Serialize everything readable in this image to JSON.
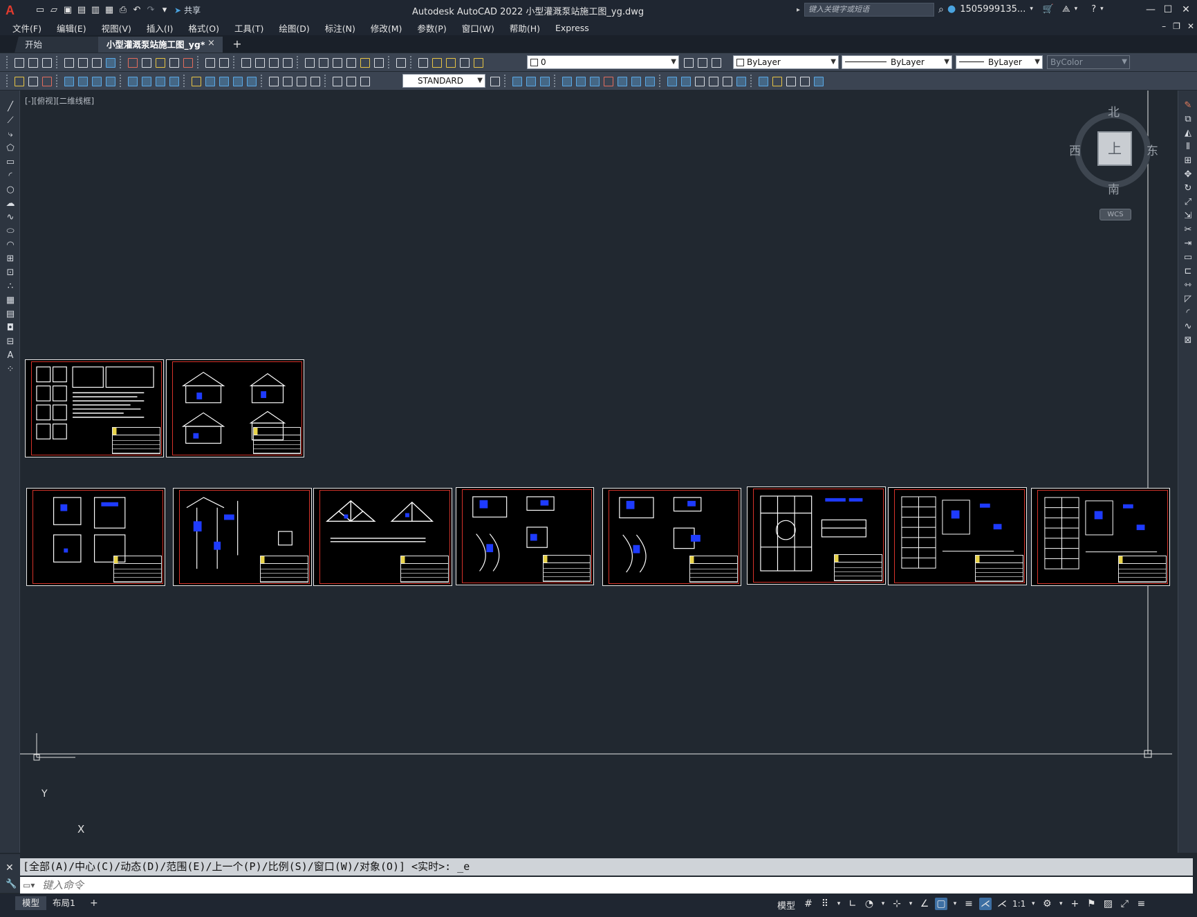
{
  "titlebar": {
    "app_logo": "A",
    "share_label": "共享",
    "title": "Autodesk AutoCAD 2022    小型灌溉泵站施工图_yg.dwg",
    "search_placeholder": "键入关键字或短语",
    "user": "1505999135...",
    "icons": [
      "new-icon",
      "open-icon",
      "save-icon",
      "saveas-icon",
      "print-icon",
      "undo-icon",
      "redo-icon",
      "share-icon",
      "search-icon",
      "user-icon",
      "cart-icon",
      "help-icon",
      "minimize-icon",
      "maximize-icon",
      "close-icon"
    ]
  },
  "menu": {
    "items": [
      "文件(F)",
      "编辑(E)",
      "视图(V)",
      "插入(I)",
      "格式(O)",
      "工具(T)",
      "绘图(D)",
      "标注(N)",
      "修改(M)",
      "参数(P)",
      "窗口(W)",
      "帮助(H)",
      "Express"
    ]
  },
  "tabs": {
    "start": "开始",
    "document": "小型灌溉泵站施工图_yg*",
    "close_glyph": "×",
    "add_glyph": "+"
  },
  "toolbar": {
    "layer": "0",
    "color": "ByLayer",
    "linetype": "ByLayer",
    "lineweight": "ByLayer",
    "plotstyle": "ByColor",
    "textstyle": "STANDARD"
  },
  "viewport": {
    "label": "[-][俯视][二维线框]"
  },
  "viewcube": {
    "north": "北",
    "south": "南",
    "east": "东",
    "west": "西",
    "face": "上",
    "wcs": "WCS"
  },
  "ucs": {
    "x": "X",
    "y": "Y"
  },
  "command": {
    "history": "[全部(A)/中心(C)/动态(D)/范围(E)/上一个(P)/比例(S)/窗口(W)/对象(O)] <实时>: _e",
    "placeholder": "键入命令"
  },
  "statusbar": {
    "model_tab": "模型",
    "layout_tab": "布局1",
    "add_tab": "+",
    "model_label": "模型",
    "scale": "1:1"
  },
  "colors": {
    "background": "#212830",
    "toolbar": "#3b4452",
    "frame_red": "#d6332a",
    "accent_blue": "#4aa3df"
  }
}
